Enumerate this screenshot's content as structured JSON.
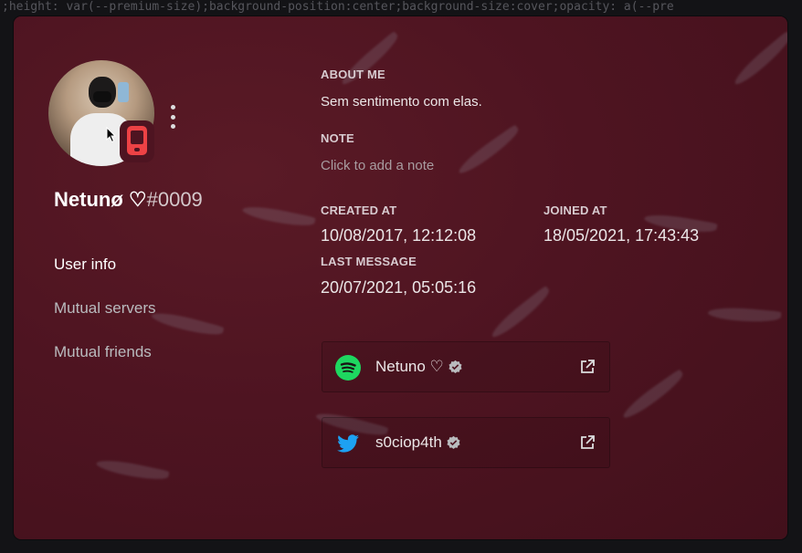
{
  "background_code": ";height: var(--premium-size);background-position:center;background-size:cover;opacity: a(--pre",
  "profile": {
    "username": "Netunø ♡",
    "discriminator": "#0009",
    "status_device": "mobile-phone-icon",
    "status_color": "#ed4245"
  },
  "nav": {
    "items": [
      {
        "label": "User info",
        "active": true
      },
      {
        "label": "Mutual servers",
        "active": false
      },
      {
        "label": "Mutual friends",
        "active": false
      }
    ]
  },
  "about_me": {
    "label": "ABOUT ME",
    "text": "Sem sentimento com elas."
  },
  "note": {
    "label": "NOTE",
    "placeholder": "Click to add a note"
  },
  "dates": {
    "created_label": "CREATED AT",
    "created_value": "10/08/2017, 12:12:08",
    "joined_label": "JOINED AT",
    "joined_value": "18/05/2021, 17:43:43",
    "last_message_label": "LAST MESSAGE",
    "last_message_value": "20/07/2021, 05:05:16"
  },
  "connections": [
    {
      "service": "spotify-icon",
      "name": "Netuno ♡",
      "verified": true,
      "color": "#1ed760"
    },
    {
      "service": "twitter-icon",
      "name": "s0ciop4th",
      "verified": true,
      "color": "#1da1f2"
    }
  ],
  "colors": {
    "modal_bg": "#4e1421",
    "accent_status": "#ed4245"
  }
}
